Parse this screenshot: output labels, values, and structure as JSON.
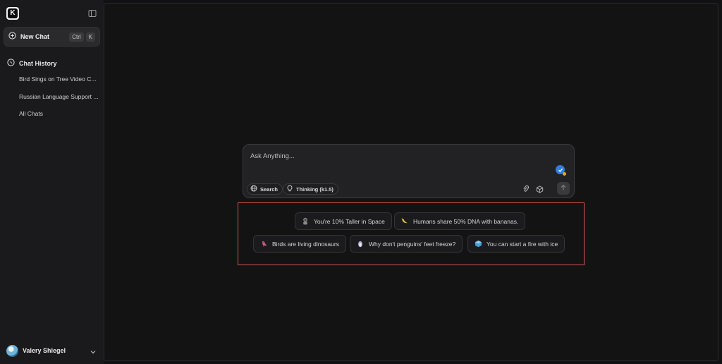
{
  "sidebar": {
    "logo_letter": "K",
    "new_chat": {
      "label": "New Chat",
      "shortcut": [
        "Ctrl",
        "K"
      ]
    },
    "history": {
      "heading": "Chat History",
      "items": [
        {
          "label": "Bird Sings on Tree Video C..."
        },
        {
          "label": "Russian Language Support ..."
        },
        {
          "label": "All Chats"
        }
      ]
    },
    "user": {
      "name": "Valery Shlegel"
    }
  },
  "composer": {
    "placeholder": "Ask Anything...",
    "search_label": "Search",
    "thinking_label": "Thinking (k1.5)"
  },
  "suggestions": [
    {
      "label": "You're 10% Taller in Space",
      "icon": "astronaut-icon"
    },
    {
      "label": "Humans share 50% DNA with bananas.",
      "icon": "banana-icon"
    },
    {
      "label": "Birds are living dinosaurs",
      "icon": "bird-icon"
    },
    {
      "label": "Why don't penguins' feet freeze?",
      "icon": "penguin-icon"
    },
    {
      "label": "You can start a fire with ice",
      "icon": "ice-cube-icon"
    }
  ],
  "colors": {
    "highlight_border": "#d9534f",
    "accent_blue": "#2f7de1",
    "background": "#111113"
  }
}
